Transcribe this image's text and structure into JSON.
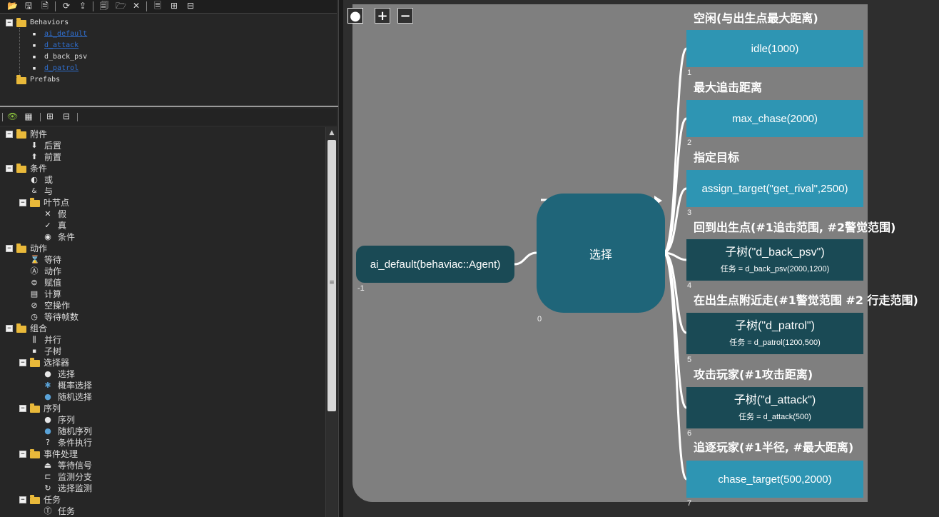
{
  "top_tree": {
    "root": "Behaviors",
    "items": [
      "ai_default",
      "d_attack",
      "d_back_psv",
      "d_patrol"
    ],
    "prefabs": "Prefabs"
  },
  "palette": {
    "attachments": {
      "label": "附件",
      "items": [
        "后置",
        "前置"
      ]
    },
    "conditions": {
      "label": "条件",
      "items": [
        "或",
        "与"
      ],
      "leaf": {
        "label": "叶节点",
        "items": [
          "假",
          "真",
          "条件"
        ]
      }
    },
    "actions": {
      "label": "动作",
      "items": [
        "等待",
        "动作",
        "赋值",
        "计算",
        "空操作",
        "等待帧数"
      ]
    },
    "composites": {
      "label": "组合",
      "items": [
        "并行",
        "子树"
      ],
      "selectors": {
        "label": "选择器",
        "items": [
          "选择",
          "概率选择",
          "随机选择"
        ]
      },
      "sequences": {
        "label": "序列",
        "items": [
          "序列",
          "随机序列",
          "条件执行"
        ]
      },
      "events": {
        "label": "事件处理",
        "items": [
          "等待信号",
          "监测分支",
          "选择监测"
        ]
      }
    },
    "tasks": {
      "label": "任务",
      "items": [
        "任务"
      ]
    }
  },
  "graph": {
    "root": {
      "label": "ai_default(behaviac::Agent)",
      "index": "-1"
    },
    "selector": {
      "label": "选择",
      "index": "0"
    },
    "children": [
      {
        "comment": "空闲(与出生点最大距离)",
        "title": "idle(1000)",
        "task": "",
        "index": "1",
        "kind": "action"
      },
      {
        "comment": "最大追击距离",
        "title": "max_chase(2000)",
        "task": "",
        "index": "2",
        "kind": "action"
      },
      {
        "comment": "指定目标",
        "title": "assign_target(\"get_rival\",2500)",
        "task": "",
        "index": "3",
        "kind": "action"
      },
      {
        "comment": "回到出生点(#1追击范围, #2警觉范围)",
        "title": "子树(\"d_back_psv\")",
        "task": "任务 = d_back_psv(2000,1200)",
        "index": "4",
        "kind": "subtree"
      },
      {
        "comment": "在出生点附近走(#1警觉范围 #2 行走范围)",
        "title": "子树(\"d_patrol\")",
        "task": "任务 = d_patrol(1200,500)",
        "index": "5",
        "kind": "subtree"
      },
      {
        "comment": "攻击玩家(#1攻击距离)",
        "title": "子树(\"d_attack\")",
        "task": "任务 = d_attack(500)",
        "index": "6",
        "kind": "subtree"
      },
      {
        "comment": "追逐玩家(#1半径, #最大距离)",
        "title": "chase_target(500,2000)",
        "task": "",
        "index": "7",
        "kind": "action"
      }
    ]
  },
  "colors": {
    "action": "#2e95b3",
    "subtree": "#1a4a55",
    "selector": "#1f6579",
    "root": "#1a4a55",
    "graph_bg": "#7f7f7f"
  }
}
